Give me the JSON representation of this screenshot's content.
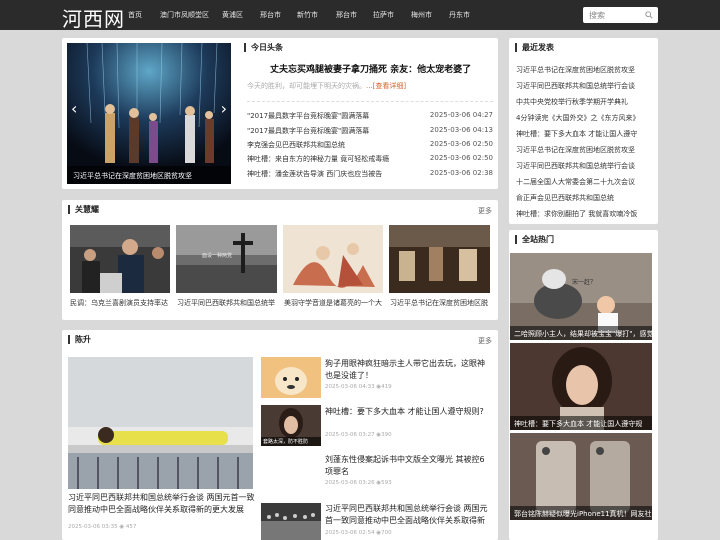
{
  "site": {
    "logo": "河西网"
  },
  "nav": [
    "首页",
    "澳门市凤顺堂区",
    "黄浦区",
    "邢台市",
    "新竹市",
    "邢台市",
    "拉萨市",
    "梅州市",
    "丹东市"
  ],
  "search": {
    "placeholder": "搜索"
  },
  "slider": {
    "caption": "习近平总书记在深度贫困地区脱贫攻坚",
    "prev": "‹",
    "next": "›"
  },
  "headlines": {
    "title": "今日头条",
    "headline": "丈夫忘买鸡腿被妻子拿刀捅死 亲友：他太宠老婆了",
    "summary": "今天的胜利，却可能埋下明天的灾祸。",
    "more": "...[查看详细]",
    "items": [
      {
        "title": "\"2017最具数字平台竞标晚宴\"圆满落幕",
        "date": "2025-03-06 04:27"
      },
      {
        "title": "\"2017最具数字平台竞标晚宴\"圆满落幕",
        "date": "2025-03-06 04:13"
      },
      {
        "title": "李克强会见巴西联邦共和国总统",
        "date": "2025-03-06 02:50"
      },
      {
        "title": "神吐槽：来自东方的神秘力量 竟可轻松戒毒瘾",
        "date": "2025-03-06 02:50"
      },
      {
        "title": "神吐槽：潘金莲状告导演 西门庆也应当被告",
        "date": "2025-03-06 02:38"
      }
    ]
  },
  "latest": {
    "title": "最近发表",
    "items": [
      "习近平总书记在深度贫困地区脱贫攻坚",
      "习近平同巴西联邦共和国总统举行会谈",
      "中共中央党校举行秋季学期开学典礼",
      "4分钟读完《大国外交》之《东方风来》",
      "神吐槽：要下多大血本 才能让国人遵守",
      "习近平总书记在深度贫困地区脱贫攻坚",
      "习近平同巴西联邦共和国总统举行会谈",
      "十二届全国人大常委会第二十九次会议",
      "俞正声会见巴西联邦共和国总统",
      "神吐槽：求你别翻拍了 我就喜欢喃冷饭"
    ]
  },
  "focus": {
    "title": "关慧耀",
    "more": "更多",
    "items": [
      "民调：乌克兰喜剧演员支持率达",
      "习近平同巴西联邦共和国总统举",
      "美羽守学音道是诸葛亮的一个大",
      "习近平总书记在深度贫困地区脱"
    ],
    "overlay_text": "面设一种两党"
  },
  "hot": {
    "title": "全站热门",
    "items": [
      "二哈照顾小主人，结果却被宝宝\"爆打\"，感觉",
      "神吐槽：要下多大血本 才能让国人遵守规",
      "郭台铭陈赫疑似曝光iPhone11真机！网友社"
    ],
    "thumb_note": "宋一赶？"
  },
  "chensheng": {
    "title": "陈升",
    "more": "更多",
    "big_title": "习近平同巴西联邦共和国总统举行会谈 两国元首一致同意推动中巴全面战略伙伴关系取得新的更大发展",
    "big_date": "2025-03-06 03:35",
    "big_views": "457",
    "articles": [
      {
        "title": "狗子用眼神疯狂暗示主人带它出去玩，这眼神也是没谁了！",
        "date": "2025-03-06 04:33",
        "views": "419"
      },
      {
        "title": "神吐槽：要下多大血本 才能让国人遵守规则?",
        "date": "2025-03-06 03:27",
        "views": "390",
        "thumb_caption": "套路太深，防不胜防"
      },
      {
        "title": "刘蓬东性侵案起诉书中文版全文曝光 其被控6项罪名",
        "date": "2025-03-06 03:26",
        "views": "593"
      },
      {
        "title": "习近平同巴西联邦共和国总统举行会谈 两国元首一致同意推动中巴全面战略伙伴关系取得新",
        "date": "2025-03-06 02:54",
        "views": "700"
      }
    ]
  }
}
